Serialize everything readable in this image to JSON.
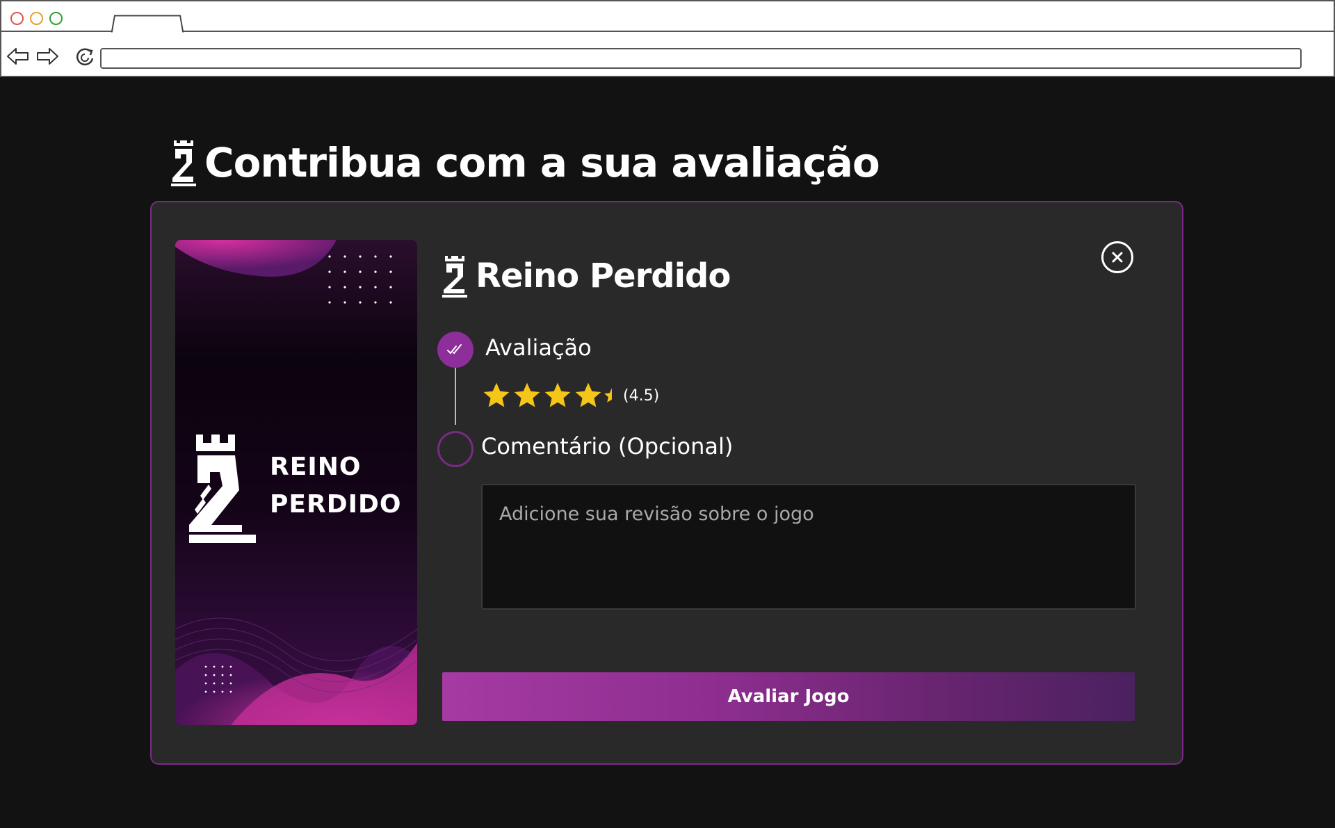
{
  "browser": {
    "url": "",
    "controls": [
      "back-icon",
      "forward-icon",
      "reload-icon"
    ]
  },
  "page": {
    "title": "Contribua com a sua avaliação",
    "logo_icon": "rook-logo-icon"
  },
  "modal": {
    "cover": {
      "title_line1": "REINO",
      "title_line2": "PERDIDO"
    },
    "game_title": "Reino Perdido",
    "close_icon": "close-icon",
    "steps": [
      {
        "label": "Avaliação",
        "status": "completed"
      },
      {
        "label": "Comentário (Opcional)",
        "status": "pending"
      }
    ],
    "rating": {
      "value": 4.5,
      "max": 5,
      "display": "(4.5)"
    },
    "comment": {
      "value": "",
      "placeholder": "Adicione sua revisão sobre o jogo"
    },
    "submit_label": "Avaliar Jogo"
  },
  "colors": {
    "background": "#121212",
    "card": "#292929",
    "accent": "#8d2e9a",
    "star": "#f5c518"
  }
}
